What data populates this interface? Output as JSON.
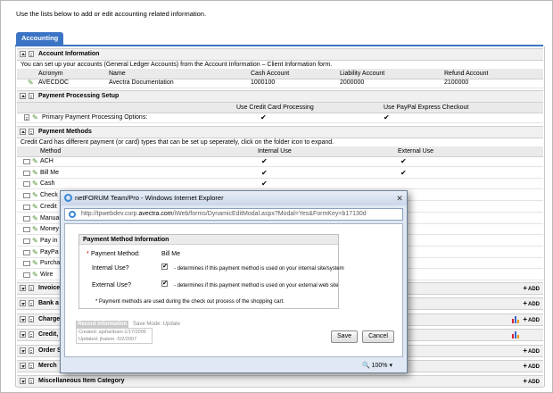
{
  "intro": "Use the lists below to add or edit accounting related information.",
  "tab": "Accounting",
  "account": {
    "title": "Account Information",
    "note": "You can set up your accounts (General Ledger Accounts) from the Account Information – Client Information form.",
    "headers": [
      "Acronym",
      "Name",
      "Cash Account",
      "Liability Account",
      "Refund Account"
    ],
    "row": [
      "AVECDOC",
      "Avectra Documentation",
      "1000100",
      "2000000",
      "2100000"
    ]
  },
  "processing": {
    "title": "Payment Processing Setup",
    "headers": [
      "Use Credit Card Processing",
      "Use PayPal Express Checkout"
    ],
    "row_label": "Primary Payment Processing Options:",
    "credit": "✔",
    "paypal": "✔"
  },
  "methods": {
    "title": "Payment Methods",
    "note": "Credit Card has different payment (or card) types that can be set up seperately, click on the folder icon to expand.",
    "headers": [
      "Method",
      "Internal Use",
      "External Use"
    ],
    "rows": [
      {
        "name": "ACH",
        "internal": "✔",
        "external": "✔"
      },
      {
        "name": "Bill Me",
        "internal": "✔",
        "external": "✔"
      },
      {
        "name": "Cash",
        "internal": "✔",
        "external": ""
      },
      {
        "name": "Check",
        "internal": "",
        "external": ""
      },
      {
        "name": "Credit",
        "internal": "",
        "external": ""
      },
      {
        "name": "Manual",
        "internal": "",
        "external": ""
      },
      {
        "name": "Money",
        "internal": "",
        "external": ""
      },
      {
        "name": "Pay in",
        "internal": "",
        "external": ""
      },
      {
        "name": "PayPa",
        "internal": "",
        "external": ""
      },
      {
        "name": "Purcha",
        "internal": "",
        "external": ""
      },
      {
        "name": "Wire",
        "internal": "",
        "external": ""
      }
    ]
  },
  "collapsed": [
    {
      "label": "Invoice",
      "chart": false
    },
    {
      "label": "Bank a",
      "chart": false
    },
    {
      "label": "Charge",
      "chart": true
    },
    {
      "label": "Credit,",
      "chart": true
    },
    {
      "label": "Order S",
      "chart": false
    },
    {
      "label": "Merch",
      "chart": false
    },
    {
      "label": "Miscellaneous Item Category",
      "chart": false
    }
  ],
  "add_label": "ADD",
  "modal": {
    "title": "netFORUM Team/Pro - Windows Internet Explorer",
    "url_prefix": "http://tpwebdev.corp.",
    "url_domain": "avectra.com",
    "url_rest": "/iWeb/forms/DynamicEditModal.aspx?Modal=Yes&FormKey=b17130d",
    "section": "Payment Method Information",
    "required": "*",
    "method_label": "Payment Method:",
    "method_value": "Bill Me",
    "internal_label": "Internal Use?",
    "internal_note": "- determines if this payment method is used on your internal site/system",
    "external_label": "External Use?",
    "external_note": "- determines if this payment method is used on your external web site",
    "check": "✔",
    "footnote": "* Payment methods are used during the check out process of the shopping cart.",
    "record_info": "Record Information",
    "save_mode": "Save Mode: Update",
    "created": "Created: ajahanbani-1/17/2005",
    "updated": "Updated: jhatem -5/2/2007",
    "save": "Save",
    "cancel": "Cancel",
    "zoom": "100%"
  },
  "colors": {
    "accent": "#3b74c4",
    "pencil": "#4a8f2a"
  }
}
